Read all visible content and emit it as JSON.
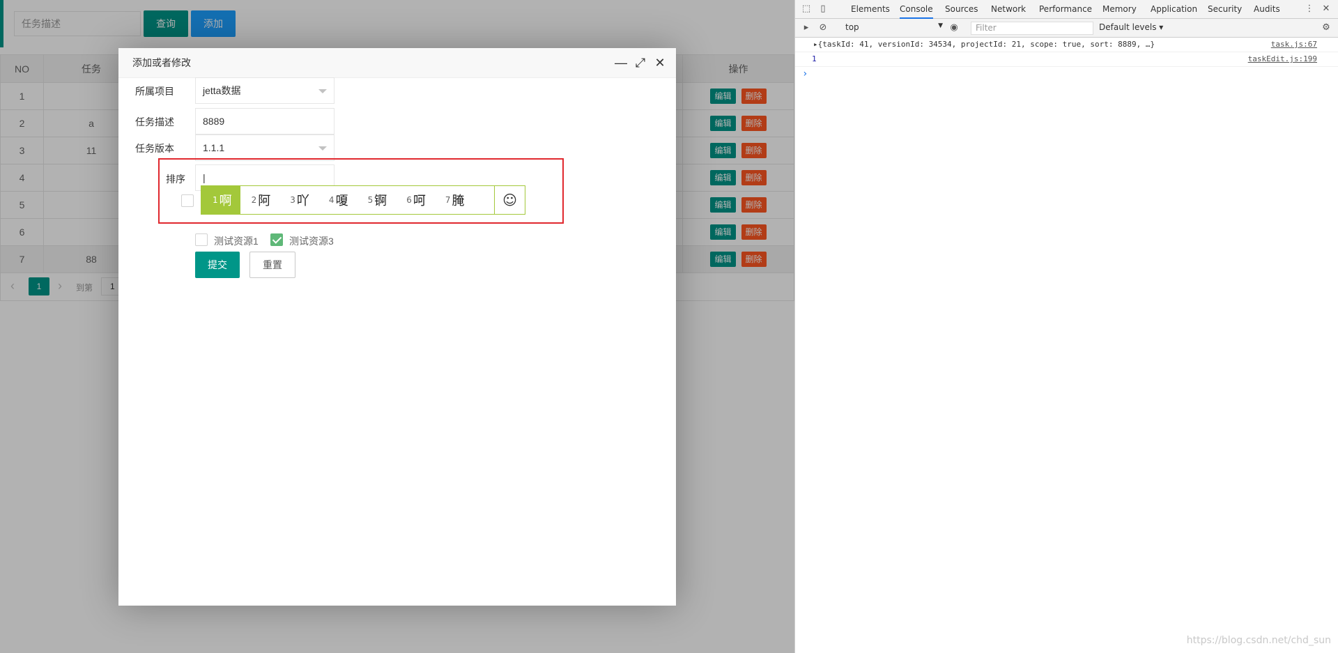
{
  "app": {
    "search": {
      "placeholder": "任务描述"
    },
    "buttons": {
      "query": "查询",
      "add": "添加"
    },
    "table": {
      "headers": [
        "NO",
        "任务",
        "操作"
      ],
      "rows": [
        {
          "no": "1",
          "name": ""
        },
        {
          "no": "2",
          "name": "a"
        },
        {
          "no": "3",
          "name": "11"
        },
        {
          "no": "4",
          "name": ""
        },
        {
          "no": "5",
          "name": ""
        },
        {
          "no": "6",
          "name": ""
        },
        {
          "no": "7",
          "name": "88"
        }
      ],
      "edit_label": "编辑",
      "delete_label": "删除"
    },
    "pager": {
      "current": "1",
      "goto_label": "到第",
      "goto_value": "1"
    }
  },
  "modal": {
    "title": "添加或者修改",
    "tools": {
      "minimize": "—",
      "maximize": "⤢",
      "close": "✕"
    },
    "fields": {
      "project": {
        "label": "所属项目",
        "value": "jetta数据"
      },
      "desc": {
        "label": "任务描述",
        "value": "8889"
      },
      "version": {
        "label": "任务版本",
        "value": "1.1.1"
      },
      "sort": {
        "label": "排序",
        "value": "|"
      }
    },
    "ime": {
      "candidates": [
        {
          "num": "1",
          "char": "啊"
        },
        {
          "num": "2",
          "char": "阿"
        },
        {
          "num": "3",
          "char": "吖"
        },
        {
          "num": "4",
          "char": "嗄"
        },
        {
          "num": "5",
          "char": "锕"
        },
        {
          "num": "6",
          "char": "呵"
        },
        {
          "num": "7",
          "char": "腌"
        }
      ],
      "emoji": "☺"
    },
    "checkboxes": [
      {
        "label": "测试资源1",
        "checked": false
      },
      {
        "label": "测试资源3",
        "checked": true
      }
    ],
    "submit_label": "提交",
    "reset_label": "重置"
  },
  "devtools": {
    "tabs": [
      "Elements",
      "Console",
      "Sources",
      "Network",
      "Performance",
      "Memory",
      "Application",
      "Security",
      "Audits"
    ],
    "active_tab": "Console",
    "context": "top",
    "filter_placeholder": "Filter",
    "levels": "Default levels ▾",
    "console": [
      {
        "text": "▸{taskId: 41, versionId: 34534, projectId: 21, scope: true, sort: 8889, …}",
        "source": "task.js:67"
      },
      {
        "text": "1",
        "source": "taskEdit.js:199"
      }
    ],
    "prompt": "›"
  },
  "watermark": "https://blog.csdn.net/chd_sun"
}
